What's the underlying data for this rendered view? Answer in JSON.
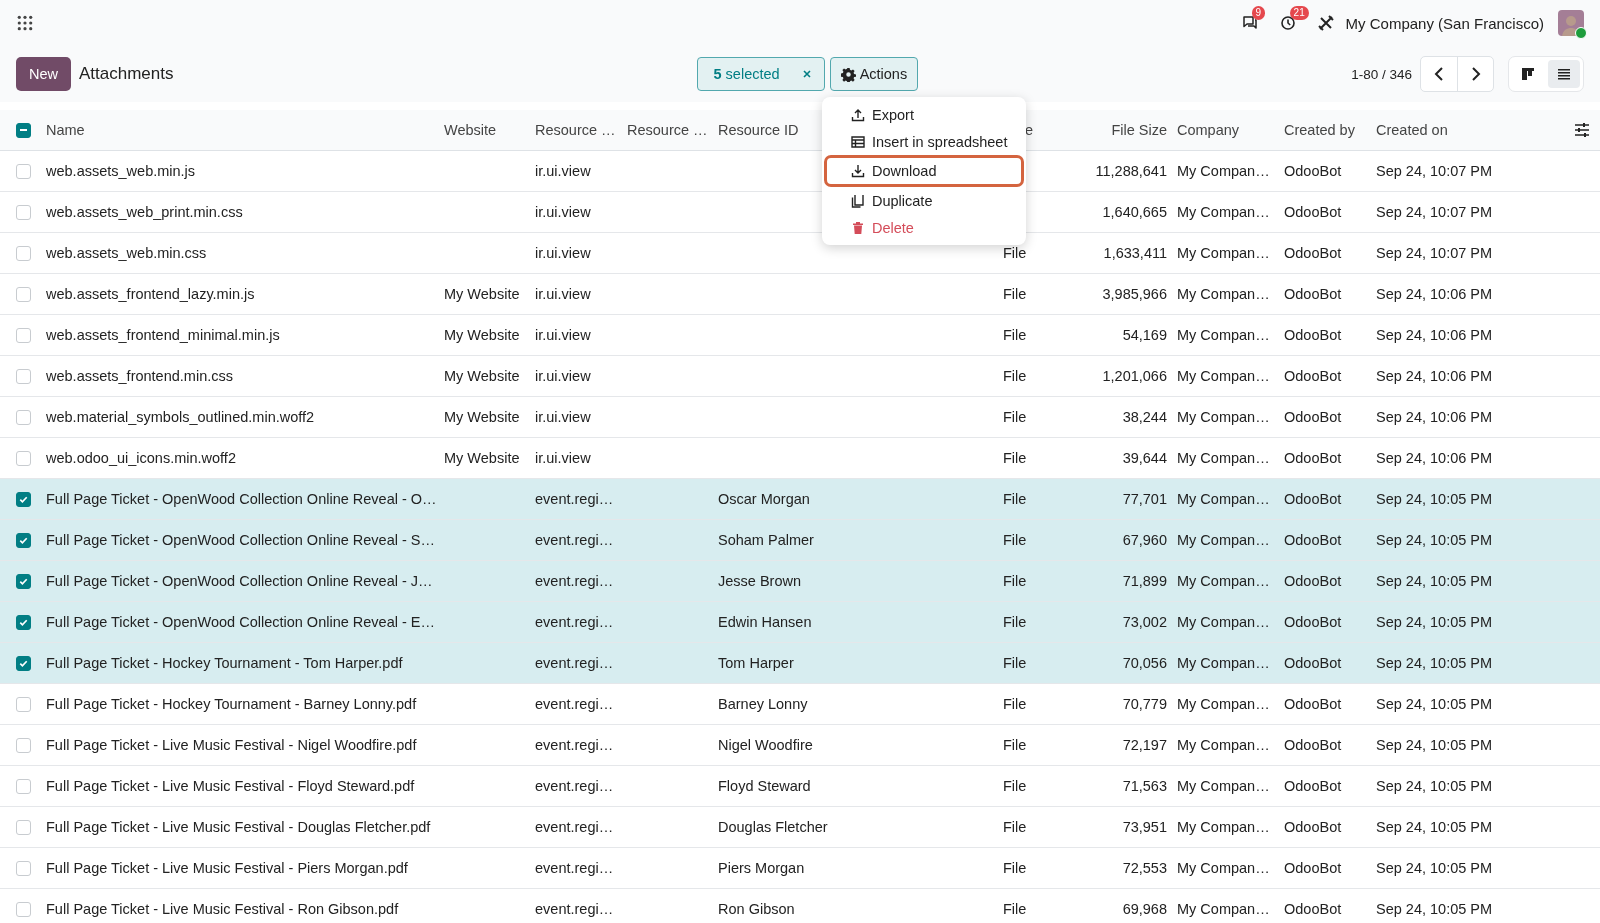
{
  "top_bar": {
    "messages_badge": "9",
    "activities_badge": "21",
    "company": "My Company (San Francisco)"
  },
  "control_panel": {
    "new_button": "New",
    "title": "Attachments",
    "selection_count": "5",
    "selection_label": "selected",
    "actions_button": "Actions",
    "pager": "1-80 / 346",
    "views": [
      {
        "kind": "kanban",
        "selected": false
      },
      {
        "kind": "list",
        "selected": true
      }
    ]
  },
  "actions_menu": [
    {
      "kind": "export",
      "label": "Export",
      "highlighted": false
    },
    {
      "kind": "spreadsheet",
      "label": "Insert in spreadsheet",
      "highlighted": false
    },
    {
      "kind": "download",
      "label": "Download",
      "highlighted": true
    },
    {
      "kind": "duplicate",
      "label": "Duplicate",
      "highlighted": false
    },
    {
      "kind": "delete",
      "label": "Delete",
      "highlighted": false
    }
  ],
  "table": {
    "select_all_partial": true,
    "columns": [
      {
        "label": "Name"
      },
      {
        "label": "Website"
      },
      {
        "label": "Resource …"
      },
      {
        "label": "Resource …"
      },
      {
        "label": "Resource ID"
      },
      {
        "label": "e"
      },
      {
        "label": "File Size"
      },
      {
        "label": "Company"
      },
      {
        "label": "Created by"
      },
      {
        "label": "Created on"
      }
    ],
    "rows": [
      {
        "selected": false,
        "name": "web.assets_web.min.js",
        "resource_model": "ir.ui.view",
        "file_size": "11,288,641",
        "company": "My Compan…",
        "created_by": "OdooBot",
        "created_on": "Sep 24, 10:07 PM"
      },
      {
        "selected": false,
        "name": "web.assets_web_print.min.css",
        "resource_model": "ir.ui.view",
        "file_size": "1,640,665",
        "company": "My Compan…",
        "created_by": "OdooBot",
        "created_on": "Sep 24, 10:07 PM"
      },
      {
        "selected": false,
        "name": "web.assets_web.min.css",
        "resource_model": "ir.ui.view",
        "type": "File",
        "file_size": "1,633,411",
        "company": "My Compan…",
        "created_by": "OdooBot",
        "created_on": "Sep 24, 10:07 PM"
      },
      {
        "selected": false,
        "name": "web.assets_frontend_lazy.min.js",
        "website": "My Website",
        "resource_model": "ir.ui.view",
        "type": "File",
        "file_size": "3,985,966",
        "company": "My Compan…",
        "created_by": "OdooBot",
        "created_on": "Sep 24, 10:06 PM"
      },
      {
        "selected": false,
        "name": "web.assets_frontend_minimal.min.js",
        "website": "My Website",
        "resource_model": "ir.ui.view",
        "type": "File",
        "file_size": "54,169",
        "company": "My Compan…",
        "created_by": "OdooBot",
        "created_on": "Sep 24, 10:06 PM"
      },
      {
        "selected": false,
        "name": "web.assets_frontend.min.css",
        "website": "My Website",
        "resource_model": "ir.ui.view",
        "type": "File",
        "file_size": "1,201,066",
        "company": "My Compan…",
        "created_by": "OdooBot",
        "created_on": "Sep 24, 10:06 PM"
      },
      {
        "selected": false,
        "name": "web.material_symbols_outlined.min.woff2",
        "website": "My Website",
        "resource_model": "ir.ui.view",
        "type": "File",
        "file_size": "38,244",
        "company": "My Compan…",
        "created_by": "OdooBot",
        "created_on": "Sep 24, 10:06 PM"
      },
      {
        "selected": false,
        "name": "web.odoo_ui_icons.min.woff2",
        "website": "My Website",
        "resource_model": "ir.ui.view",
        "type": "File",
        "file_size": "39,644",
        "company": "My Compan…",
        "created_by": "OdooBot",
        "created_on": "Sep 24, 10:06 PM"
      },
      {
        "selected": true,
        "name": "Full Page Ticket - OpenWood Collection Online Reveal - O…",
        "resource_model": "event.regi…",
        "resource_id": "Oscar Morgan",
        "type": "File",
        "file_size": "77,701",
        "company": "My Compan…",
        "created_by": "OdooBot",
        "created_on": "Sep 24, 10:05 PM"
      },
      {
        "selected": true,
        "name": "Full Page Ticket - OpenWood Collection Online Reveal - S…",
        "resource_model": "event.regi…",
        "resource_id": "Soham Palmer",
        "type": "File",
        "file_size": "67,960",
        "company": "My Compan…",
        "created_by": "OdooBot",
        "created_on": "Sep 24, 10:05 PM"
      },
      {
        "selected": true,
        "name": "Full Page Ticket - OpenWood Collection Online Reveal - J…",
        "resource_model": "event.regi…",
        "resource_id": "Jesse Brown",
        "type": "File",
        "file_size": "71,899",
        "company": "My Compan…",
        "created_by": "OdooBot",
        "created_on": "Sep 24, 10:05 PM"
      },
      {
        "selected": true,
        "name": "Full Page Ticket - OpenWood Collection Online Reveal - E…",
        "resource_model": "event.regi…",
        "resource_id": "Edwin Hansen",
        "type": "File",
        "file_size": "73,002",
        "company": "My Compan…",
        "created_by": "OdooBot",
        "created_on": "Sep 24, 10:05 PM"
      },
      {
        "selected": true,
        "name": "Full Page Ticket - Hockey Tournament - Tom Harper.pdf",
        "resource_model": "event.regi…",
        "resource_id": "Tom Harper",
        "type": "File",
        "file_size": "70,056",
        "company": "My Compan…",
        "created_by": "OdooBot",
        "created_on": "Sep 24, 10:05 PM"
      },
      {
        "selected": false,
        "name": "Full Page Ticket - Hockey Tournament - Barney Lonny.pdf",
        "resource_model": "event.regi…",
        "resource_id": "Barney Lonny",
        "type": "File",
        "file_size": "70,779",
        "company": "My Compan…",
        "created_by": "OdooBot",
        "created_on": "Sep 24, 10:05 PM"
      },
      {
        "selected": false,
        "name": "Full Page Ticket - Live Music Festival - Nigel Woodfire.pdf",
        "resource_model": "event.regi…",
        "resource_id": "Nigel Woodfire",
        "type": "File",
        "file_size": "72,197",
        "company": "My Compan…",
        "created_by": "OdooBot",
        "created_on": "Sep 24, 10:05 PM"
      },
      {
        "selected": false,
        "name": "Full Page Ticket - Live Music Festival - Floyd Steward.pdf",
        "resource_model": "event.regi…",
        "resource_id": "Floyd Steward",
        "type": "File",
        "file_size": "71,563",
        "company": "My Compan…",
        "created_by": "OdooBot",
        "created_on": "Sep 24, 10:05 PM"
      },
      {
        "selected": false,
        "name": "Full Page Ticket - Live Music Festival - Douglas Fletcher.pdf",
        "resource_model": "event.regi…",
        "resource_id": "Douglas Fletcher",
        "type": "File",
        "file_size": "73,951",
        "company": "My Compan…",
        "created_by": "OdooBot",
        "created_on": "Sep 24, 10:05 PM"
      },
      {
        "selected": false,
        "name": "Full Page Ticket - Live Music Festival - Piers Morgan.pdf",
        "resource_model": "event.regi…",
        "resource_id": "Piers Morgan",
        "type": "File",
        "file_size": "72,553",
        "company": "My Compan…",
        "created_by": "OdooBot",
        "created_on": "Sep 24, 10:05 PM"
      },
      {
        "selected": false,
        "name": "Full Page Ticket - Live Music Festival - Ron Gibson.pdf",
        "resource_model": "event.regi…",
        "resource_id": "Ron Gibson",
        "type": "File",
        "file_size": "69,968",
        "company": "My Compan…",
        "created_by": "OdooBot",
        "created_on": "Sep 24, 10:05 PM"
      }
    ]
  }
}
